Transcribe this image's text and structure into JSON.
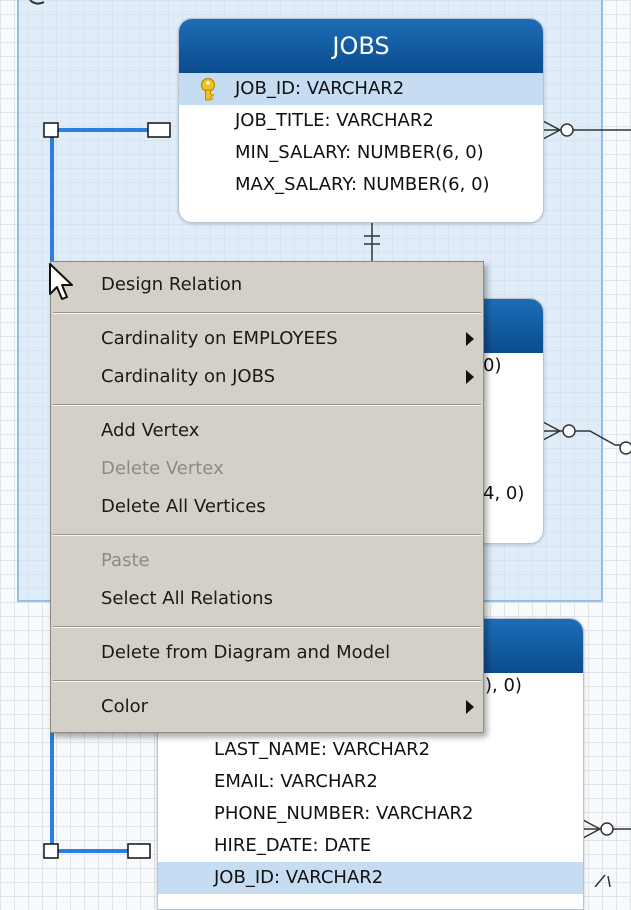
{
  "jobs_table": {
    "title": "JOBS",
    "columns": [
      {
        "text": "JOB_ID: VARCHAR2",
        "primary_key": true
      },
      {
        "text": "JOB_TITLE: VARCHAR2"
      },
      {
        "text": "MIN_SALARY: NUMBER(6, 0)"
      },
      {
        "text": "MAX_SALARY: NUMBER(6, 0)"
      }
    ]
  },
  "middle_table": {
    "partial_texts": [
      "0)",
      "4, 0)"
    ]
  },
  "employees_table": {
    "partial_text": "), 0)",
    "columns": [
      {
        "text": "LAST_NAME: VARCHAR2"
      },
      {
        "text": "EMAIL: VARCHAR2"
      },
      {
        "text": "PHONE_NUMBER: VARCHAR2"
      },
      {
        "text": "HIRE_DATE: DATE"
      },
      {
        "text": "JOB_ID: VARCHAR2",
        "highlighted": true
      }
    ]
  },
  "context_menu": {
    "items": [
      {
        "label": "Design Relation",
        "enabled": true
      },
      {
        "label": "Cardinality on EMPLOYEES",
        "enabled": true,
        "submenu": true
      },
      {
        "label": "Cardinality on JOBS",
        "enabled": true,
        "submenu": true
      },
      {
        "label": "Add Vertex",
        "enabled": true
      },
      {
        "label": "Delete Vertex",
        "enabled": false
      },
      {
        "label": "Delete All Vertices",
        "enabled": true
      },
      {
        "label": "Paste",
        "enabled": false
      },
      {
        "label": "Select All Relations",
        "enabled": true
      },
      {
        "label": "Delete from Diagram and Model",
        "enabled": true
      },
      {
        "label": "Color",
        "enabled": true,
        "submenu": true
      }
    ]
  },
  "colors": {
    "header_blue": "#0f5aa0",
    "selected_relation": "#2b7fe0",
    "menu_bg": "#d4d0c8",
    "pk_row": "#c6dcf3"
  },
  "icons": [
    "key-icon",
    "arrow-cursor-icon",
    "submenu-arrow-icon",
    "crows-foot-icon",
    "one-cardinality-icon"
  ]
}
